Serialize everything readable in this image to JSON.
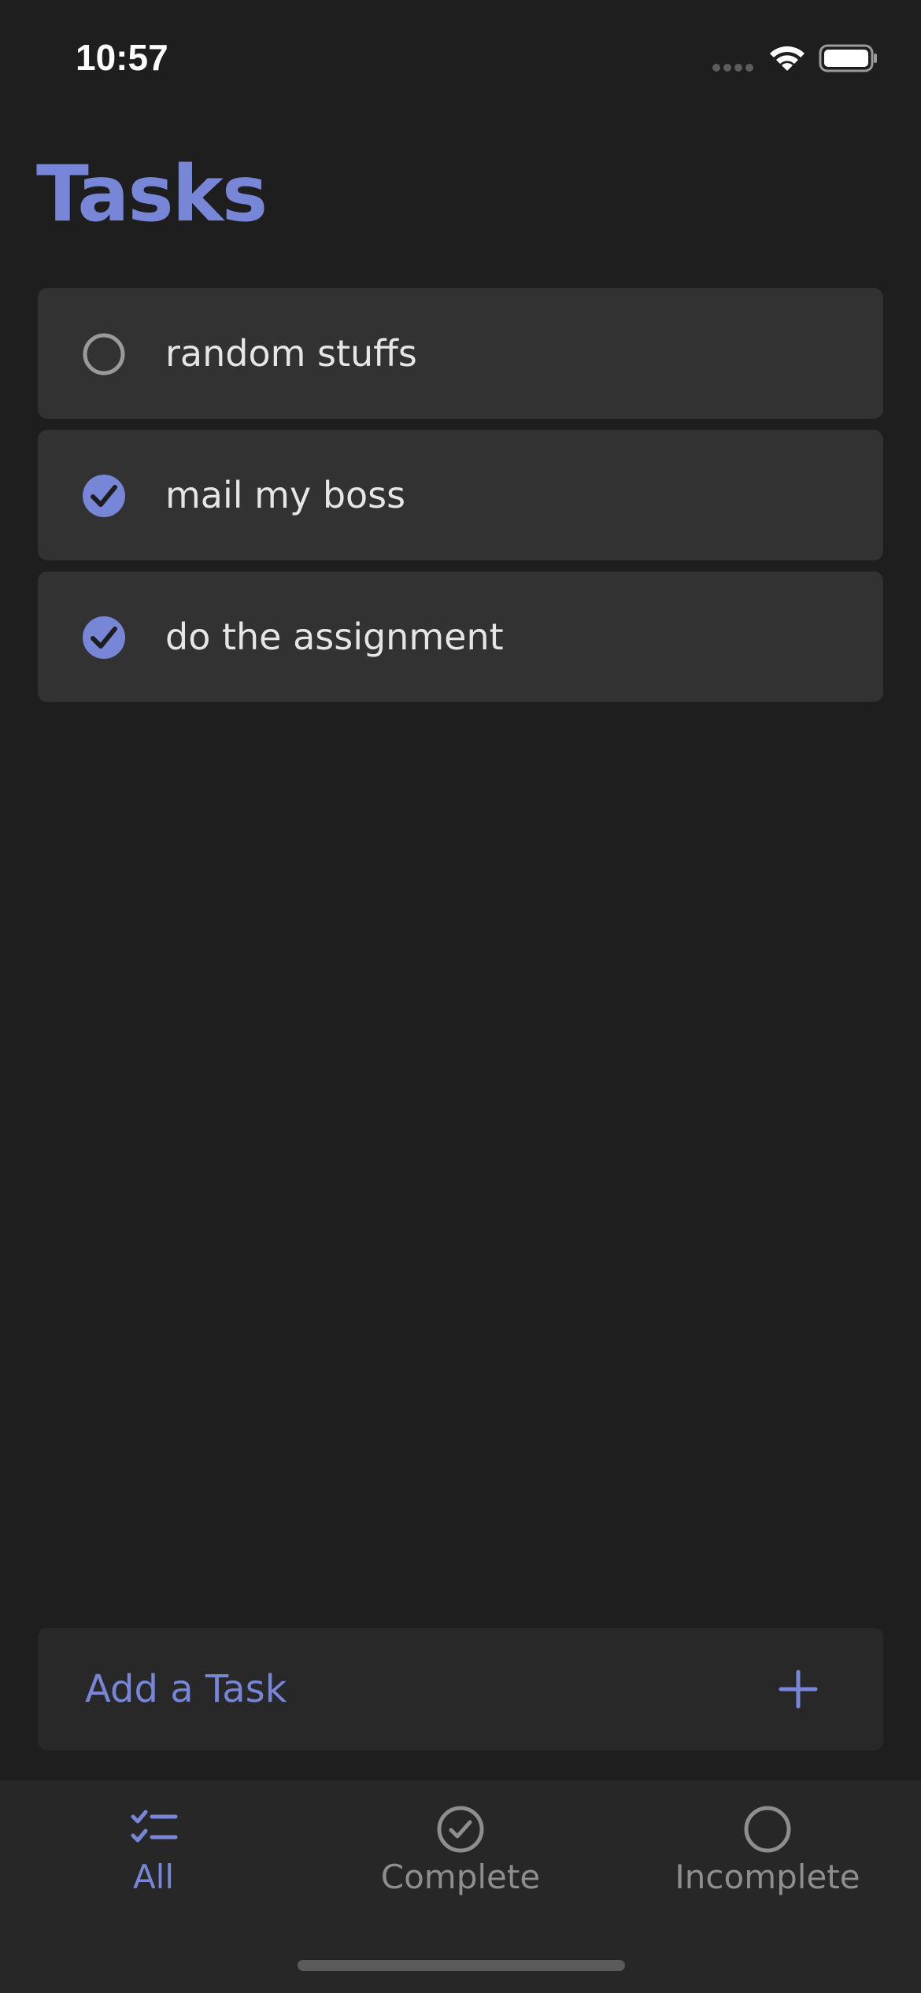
{
  "status_bar": {
    "time": "10:57"
  },
  "page": {
    "title": "Tasks"
  },
  "tasks": [
    {
      "label": "random stuffs",
      "completed": false
    },
    {
      "label": "mail my boss",
      "completed": true
    },
    {
      "label": "do the assignment",
      "completed": true
    }
  ],
  "add_task": {
    "label": "Add a Task",
    "icon": "plus-icon"
  },
  "tabs": [
    {
      "label": "All",
      "icon": "checklist-icon",
      "active": true
    },
    {
      "label": "Complete",
      "icon": "check-circle-icon",
      "active": false
    },
    {
      "label": "Incomplete",
      "icon": "empty-circle-icon",
      "active": false
    }
  ],
  "colors": {
    "accent": "#7886d7",
    "background": "#1e1e1e",
    "card": "#323232",
    "text": "#e6e6e6",
    "muted": "#8e8e8e"
  }
}
